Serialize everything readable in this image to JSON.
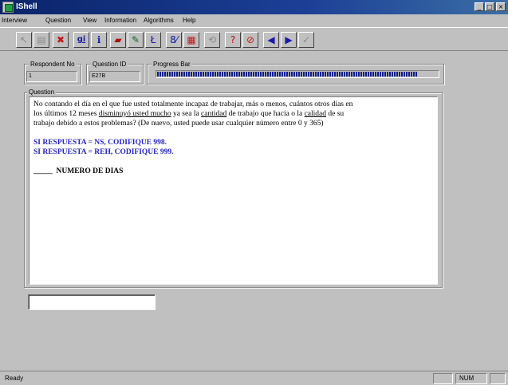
{
  "window": {
    "title": "IShell",
    "controls": {
      "minimize": "_",
      "maximize": "□",
      "close": "×"
    }
  },
  "menu": {
    "items": [
      "Interview",
      "Question",
      "View",
      "Information",
      "Algorithms",
      "Help"
    ]
  },
  "toolbar": {
    "buttons": [
      {
        "icon": "arrow-icon",
        "glyph": "↖",
        "enabled": false
      },
      {
        "icon": "save-icon",
        "glyph": "▤",
        "enabled": false
      },
      {
        "icon": "delete-icon",
        "glyph": "✖",
        "enabled": true,
        "color": "#c81414"
      },
      {
        "icon": "gi-icon",
        "glyph": "gi",
        "enabled": true,
        "color": "#1a1aa8"
      },
      {
        "icon": "info-icon",
        "glyph": "ℹ",
        "enabled": true,
        "color": "#1a1aa8"
      },
      {
        "icon": "book-icon",
        "glyph": "▰",
        "enabled": true,
        "color": "#b01010"
      },
      {
        "icon": "edit-icon",
        "glyph": "✎",
        "enabled": true,
        "color": "#0a6a2a"
      },
      {
        "icon": "translate-icon",
        "glyph": "Ł",
        "enabled": true,
        "color": "#1a1aa8"
      },
      {
        "icon": "code-icon",
        "glyph": "8⁄",
        "enabled": true,
        "color": "#1a1aa8"
      },
      {
        "icon": "color-grid-icon",
        "glyph": "▦",
        "enabled": true,
        "color": "#c81414"
      },
      {
        "icon": "refresh-icon",
        "glyph": "⟲",
        "enabled": false
      },
      {
        "icon": "help-icon",
        "glyph": "?",
        "enabled": true,
        "color": "#b01010"
      },
      {
        "icon": "no-icon",
        "glyph": "⊘",
        "enabled": true,
        "color": "#c81414"
      },
      {
        "icon": "previous-icon",
        "glyph": "◀",
        "enabled": true,
        "color": "#1a1aa8"
      },
      {
        "icon": "next-icon",
        "glyph": "▶",
        "enabled": true,
        "color": "#1a1aa8"
      },
      {
        "icon": "check-icon",
        "glyph": "✓",
        "enabled": false
      }
    ]
  },
  "respondent": {
    "label": "Respondent No",
    "value": "1"
  },
  "question_id": {
    "label": "Question ID",
    "value": "E27B"
  },
  "progress": {
    "label": "Progress Bar",
    "fraction": 0.93
  },
  "question": {
    "label": "Question",
    "line1": "No contando el día en el que fue usted totalmente incapaz de trabajar, más o menos,  cuántos otros días en",
    "line2_pre": "los últimos 12 meses ",
    "line2_u1": "disminuyó usted mucho",
    "line2_mid": " ya sea la ",
    "line2_u2": "cantidad",
    "line2_mid2": " de trabajo que hacía o la ",
    "line2_u3": "calidad",
    "line2_post": " de su",
    "line3": "trabajo debido a estos problemas?  (De nuevo, usted puede usar cualquier número entre 0 y 365)",
    "instruction1": "SI RESPUESTA =  NS,   CODIFIQUE 998.",
    "instruction2": "SI RESPUESTA = REH, CODIFIQUE 999.",
    "answer_blank": "_____",
    "answer_label": "  NUMERO DE DIAS"
  },
  "answer": {
    "value": "",
    "placeholder": ""
  },
  "status": {
    "text": "Ready",
    "indicator": "NUM"
  }
}
